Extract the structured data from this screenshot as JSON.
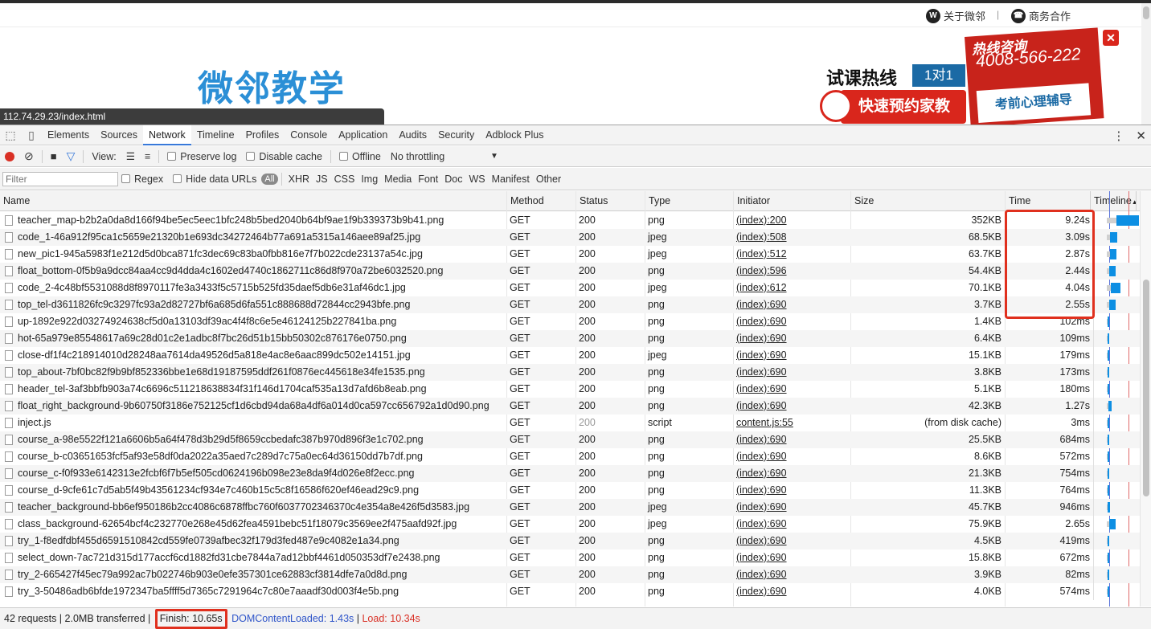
{
  "site": {
    "top_links": [
      "关于微邻",
      "商务合作"
    ],
    "logo": "微邻教学",
    "url_tip": "112.74.29.23/index.html",
    "hotline_label": "试课热线",
    "badge": "1对1",
    "book_button": "快速预约家教",
    "promo_title": "热线咨询",
    "promo_phone": "4008-566-222",
    "promo_subtitle": "考前心理辅导"
  },
  "devtools": {
    "tabs": [
      "Elements",
      "Sources",
      "Network",
      "Timeline",
      "Profiles",
      "Console",
      "Application",
      "Audits",
      "Security",
      "Adblock Plus"
    ],
    "active_tab": "Network",
    "toolbar": {
      "view_label": "View:",
      "preserve_log": "Preserve log",
      "disable_cache": "Disable cache",
      "offline": "Offline",
      "throttling": "No throttling"
    },
    "filter": {
      "placeholder": "Filter",
      "regex": "Regex",
      "hide_data_urls": "Hide data URLs",
      "types": [
        "All",
        "XHR",
        "JS",
        "CSS",
        "Img",
        "Media",
        "Font",
        "Doc",
        "WS",
        "Manifest",
        "Other"
      ]
    },
    "columns": [
      "Name",
      "Method",
      "Status",
      "Type",
      "Initiator",
      "Size",
      "Time",
      "Timeline",
      "St"
    ],
    "rows": [
      {
        "name": "teacher_map-b2b2a0da8d166f94be5ec5eec1bfc248b5bed2040b64bf9ae1f9b339373b9b41.png",
        "method": "GET",
        "status": "200",
        "type": "png",
        "initiator": "(index):200",
        "size": "352KB",
        "time": "9.24s"
      },
      {
        "name": "code_1-46a912f95ca1c5659e21320b1e693dc34272464b77a691a5315a146aee89af25.jpg",
        "method": "GET",
        "status": "200",
        "type": "jpeg",
        "initiator": "(index):508",
        "size": "68.5KB",
        "time": "3.09s"
      },
      {
        "name": "new_pic1-945a5983f1e212d5d0bca871fc3dec69c83ba0fbb816e7f7b022cde23137a54c.jpg",
        "method": "GET",
        "status": "200",
        "type": "jpeg",
        "initiator": "(index):512",
        "size": "63.7KB",
        "time": "2.87s"
      },
      {
        "name": "float_bottom-0f5b9a9dcc84aa4cc9d4dda4c1602ed4740c1862711c86d8f970a72be6032520.png",
        "method": "GET",
        "status": "200",
        "type": "png",
        "initiator": "(index):596",
        "size": "54.4KB",
        "time": "2.44s"
      },
      {
        "name": "code_2-4c48bf5531088d8f8970117fe3a3433f5c5715b525fd35daef5db6e31af46dc1.jpg",
        "method": "GET",
        "status": "200",
        "type": "jpeg",
        "initiator": "(index):612",
        "size": "70.1KB",
        "time": "4.04s"
      },
      {
        "name": "top_tel-d3611826fc9c3297fc93a2d82727bf6a685d6fa551c888688d72844cc2943bfe.png",
        "method": "GET",
        "status": "200",
        "type": "png",
        "initiator": "(index):690",
        "size": "3.7KB",
        "time": "2.55s"
      },
      {
        "name": "up-1892e922d03274924638cf5d0a13103df39ac4f4f8c6e5e46124125b227841ba.png",
        "method": "GET",
        "status": "200",
        "type": "png",
        "initiator": "(index):690",
        "size": "1.4KB",
        "time": "102ms"
      },
      {
        "name": "hot-65a979e85548617a69c28d01c2e1adbc8f7bc26d51b15bb50302c876176e0750.png",
        "method": "GET",
        "status": "200",
        "type": "png",
        "initiator": "(index):690",
        "size": "6.4KB",
        "time": "109ms"
      },
      {
        "name": "close-df1f4c218914010d28248aa7614da49526d5a818e4ac8e6aac899dc502e14151.jpg",
        "method": "GET",
        "status": "200",
        "type": "jpeg",
        "initiator": "(index):690",
        "size": "15.1KB",
        "time": "179ms"
      },
      {
        "name": "top_about-7bf0bc82f9b9bf852336bbe1e68d19187595ddf261f0876ec445618e34fe1535.png",
        "method": "GET",
        "status": "200",
        "type": "png",
        "initiator": "(index):690",
        "size": "3.8KB",
        "time": "173ms"
      },
      {
        "name": "header_tel-3af3bbfb903a74c6696c511218638834f31f146d1704caf535a13d7afd6b8eab.png",
        "method": "GET",
        "status": "200",
        "type": "png",
        "initiator": "(index):690",
        "size": "5.1KB",
        "time": "180ms"
      },
      {
        "name": "float_right_background-9b60750f3186e752125cf1d6cbd94da68a4df6a014d0ca597cc656792a1d0d90.png",
        "method": "GET",
        "status": "200",
        "type": "png",
        "initiator": "(index):690",
        "size": "42.3KB",
        "time": "1.27s"
      },
      {
        "name": "inject.js",
        "method": "GET",
        "status": "200",
        "type": "script",
        "initiator": "content.js:55",
        "size": "(from disk cache)",
        "time": "3ms"
      },
      {
        "name": "course_a-98e5522f121a6606b5a64f478d3b29d5f8659ccbedafc387b970d896f3e1c702.png",
        "method": "GET",
        "status": "200",
        "type": "png",
        "initiator": "(index):690",
        "size": "25.5KB",
        "time": "684ms"
      },
      {
        "name": "course_b-c03651653fcf5af93e58df0da2022a35aed7c289d7c75a0ec64d36150dd7b7df.png",
        "method": "GET",
        "status": "200",
        "type": "png",
        "initiator": "(index):690",
        "size": "8.6KB",
        "time": "572ms"
      },
      {
        "name": "course_c-f0f933e6142313e2fcbf6f7b5ef505cd0624196b098e23e8da9f4d026e8f2ecc.png",
        "method": "GET",
        "status": "200",
        "type": "png",
        "initiator": "(index):690",
        "size": "21.3KB",
        "time": "754ms"
      },
      {
        "name": "course_d-9cfe61c7d5ab5f49b43561234cf934e7c460b15c5c8f16586f620ef46ead29c9.png",
        "method": "GET",
        "status": "200",
        "type": "png",
        "initiator": "(index):690",
        "size": "11.3KB",
        "time": "764ms"
      },
      {
        "name": "teacher_background-bb6ef950186b2cc4086c6878ffbc760f6037702346370c4e354a8e426f5d3583.jpg",
        "method": "GET",
        "status": "200",
        "type": "jpeg",
        "initiator": "(index):690",
        "size": "45.7KB",
        "time": "946ms"
      },
      {
        "name": "class_background-62654bcf4c232770e268e45d62fea4591bebc51f18079c3569ee2f475aafd92f.jpg",
        "method": "GET",
        "status": "200",
        "type": "jpeg",
        "initiator": "(index):690",
        "size": "75.9KB",
        "time": "2.65s"
      },
      {
        "name": "try_1-f8edfdbf455d6591510842cd559fe0739afbec32f179d3fed487e9c4082e1a34.png",
        "method": "GET",
        "status": "200",
        "type": "png",
        "initiator": "(index):690",
        "size": "4.5KB",
        "time": "419ms"
      },
      {
        "name": "select_down-7ac721d315d177accf6cd1882fd31cbe7844a7ad12bbf4461d050353df7e2438.png",
        "method": "GET",
        "status": "200",
        "type": "png",
        "initiator": "(index):690",
        "size": "15.8KB",
        "time": "672ms"
      },
      {
        "name": "try_2-665427f45ec79a992ac7b022746b903e0efe357301ce62883cf3814dfe7a0d8d.png",
        "method": "GET",
        "status": "200",
        "type": "png",
        "initiator": "(index):690",
        "size": "3.9KB",
        "time": "82ms"
      },
      {
        "name": "try_3-50486adb6bfde1972347ba5ffff5d7365c7291964c7c80e7aaadf30d003f4e5b.png",
        "method": "GET",
        "status": "200",
        "type": "png",
        "initiator": "(index):690",
        "size": "4.0KB",
        "time": "574ms"
      }
    ],
    "status_bar": {
      "requests": "42 requests",
      "transferred": "2.0MB transferred",
      "finish": "Finish: 10.65s",
      "dom_content_loaded": "DOMContentLoaded: 1.43s",
      "load": "Load: 10.34s"
    },
    "colors": {
      "accent": "#3879d9",
      "highlight": "#e0301e",
      "timeline_bar": "#0d8fe3"
    }
  }
}
